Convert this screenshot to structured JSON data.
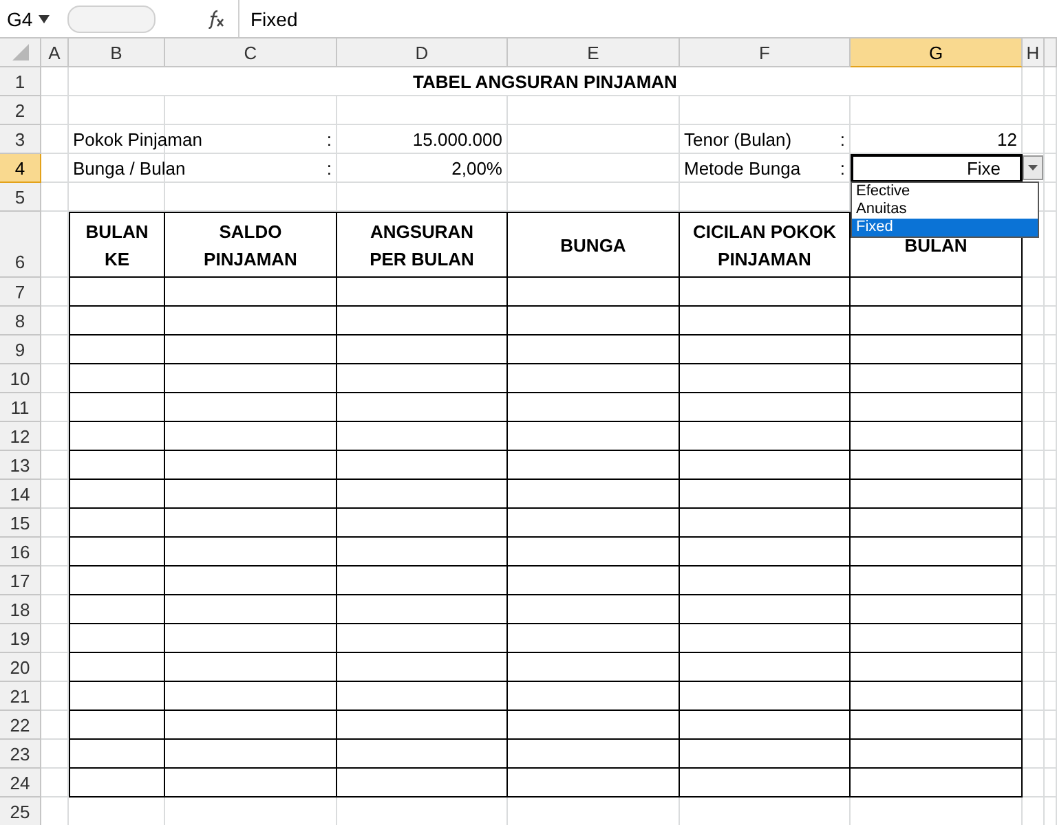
{
  "formula_bar": {
    "name_box": "G4",
    "formula": "Fixed"
  },
  "columns": [
    {
      "label": "A",
      "selected": false
    },
    {
      "label": "B",
      "selected": false
    },
    {
      "label": "C",
      "selected": false
    },
    {
      "label": "D",
      "selected": false
    },
    {
      "label": "E",
      "selected": false
    },
    {
      "label": "F",
      "selected": false
    },
    {
      "label": "G",
      "selected": true
    },
    {
      "label": "H",
      "selected": false
    }
  ],
  "rows": [
    {
      "label": "1",
      "selected": false
    },
    {
      "label": "2",
      "selected": false
    },
    {
      "label": "3",
      "selected": false
    },
    {
      "label": "4",
      "selected": true
    },
    {
      "label": "5",
      "selected": false
    },
    {
      "label": "6",
      "selected": false
    },
    {
      "label": "7",
      "selected": false
    },
    {
      "label": "8",
      "selected": false
    },
    {
      "label": "9",
      "selected": false
    },
    {
      "label": "10",
      "selected": false
    },
    {
      "label": "11",
      "selected": false
    },
    {
      "label": "12",
      "selected": false
    },
    {
      "label": "13",
      "selected": false
    },
    {
      "label": "14",
      "selected": false
    },
    {
      "label": "15",
      "selected": false
    },
    {
      "label": "16",
      "selected": false
    },
    {
      "label": "17",
      "selected": false
    },
    {
      "label": "18",
      "selected": false
    },
    {
      "label": "19",
      "selected": false
    },
    {
      "label": "20",
      "selected": false
    },
    {
      "label": "21",
      "selected": false
    },
    {
      "label": "22",
      "selected": false
    },
    {
      "label": "23",
      "selected": false
    },
    {
      "label": "24",
      "selected": false
    },
    {
      "label": "25",
      "selected": false
    }
  ],
  "title": "TABEL ANGSURAN PINJAMAN",
  "left_fields": [
    {
      "label": "Pokok Pinjaman",
      "colon": ":",
      "value": "15.000.000"
    },
    {
      "label": "Bunga / Bulan",
      "colon": ":",
      "value": "2,00%"
    }
  ],
  "right_fields": [
    {
      "label": "Tenor (Bulan)",
      "colon": ":",
      "value": "12"
    },
    {
      "label": "Metode Bunga",
      "colon": ":",
      "value": "Fixe"
    }
  ],
  "table": {
    "columns": [
      {
        "lines": [
          "BULAN",
          "KE"
        ]
      },
      {
        "lines": [
          "SALDO",
          "PINJAMAN"
        ]
      },
      {
        "lines": [
          "ANGSURAN",
          "PER BULAN"
        ]
      },
      {
        "lines": [
          "BUNGA"
        ]
      },
      {
        "lines": [
          "CICILAN POKOK",
          "PINJAMAN"
        ]
      },
      {
        "lines": [
          "BULAN"
        ]
      }
    ]
  },
  "dropdown": {
    "options": [
      {
        "label": "Efective",
        "selected": false
      },
      {
        "label": "Anuitas",
        "selected": false
      },
      {
        "label": "Fixed",
        "selected": true
      }
    ]
  }
}
